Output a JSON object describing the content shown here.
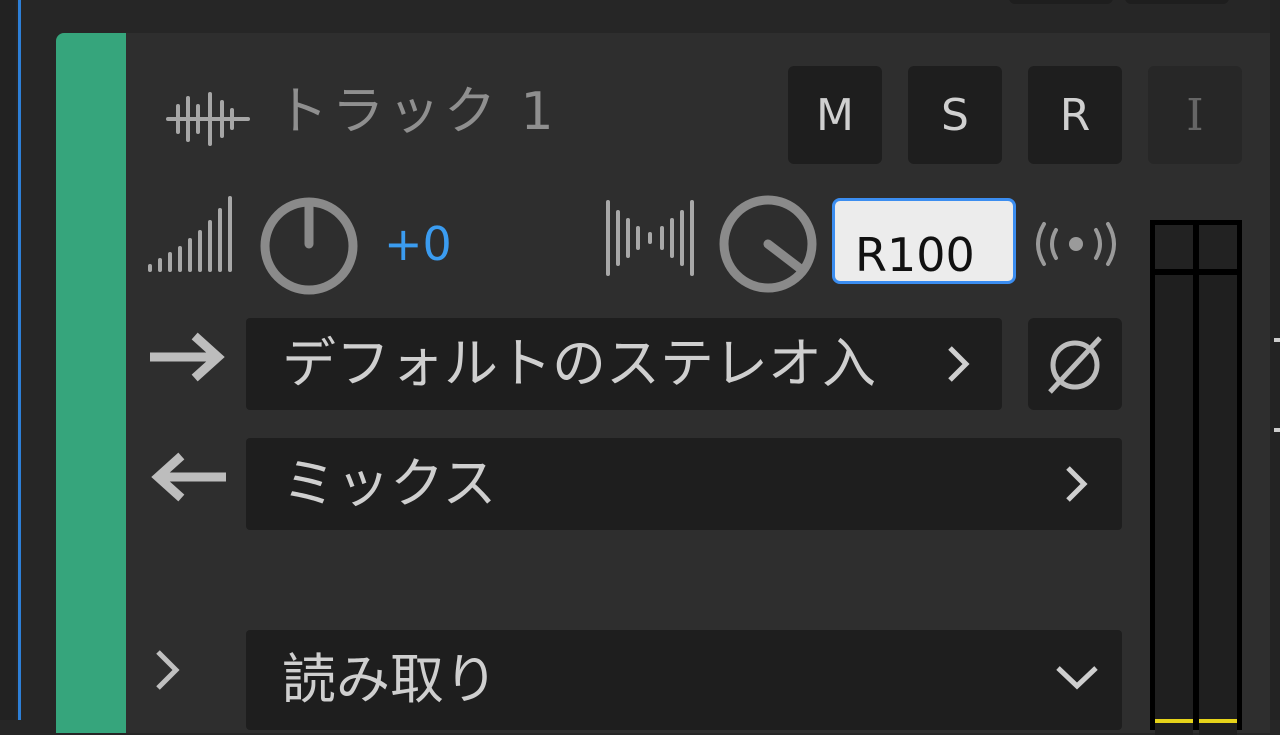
{
  "track": {
    "name": "トラック 1",
    "color": "#36a57c",
    "icon": "waveform-icon"
  },
  "buttons": {
    "mute": "M",
    "solo": "S",
    "record": "R",
    "input_monitor": "I"
  },
  "volume": {
    "icon": "volume-ramp-icon",
    "value": "+0"
  },
  "pan": {
    "icon": "pan-bars-icon",
    "value": "R100"
  },
  "monitor_icon": "broadcast-icon",
  "input": {
    "icon": "arrow-right-icon",
    "label": "デフォルトのステレオ入",
    "phase_icon": "phase-invert-icon"
  },
  "output": {
    "icon": "arrow-left-icon",
    "label": "ミックス"
  },
  "automation": {
    "mode": "読み取り",
    "icon": "chevron-down-icon"
  },
  "colors": {
    "accent_blue": "#3b9cf0",
    "meter_level": "#e6d31a",
    "selection_border": "#3b8df0"
  }
}
